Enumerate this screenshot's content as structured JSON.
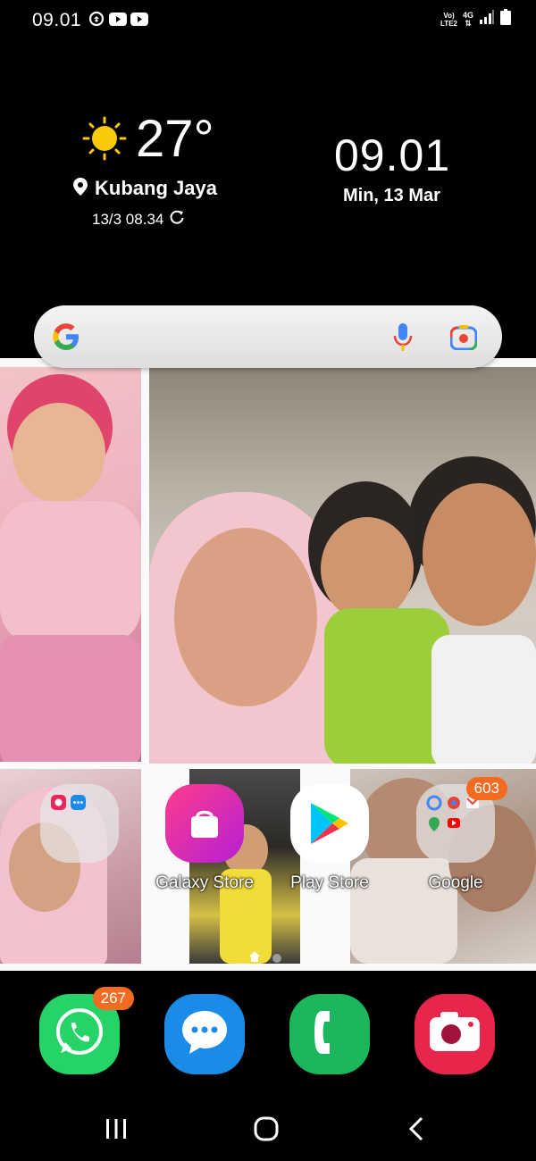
{
  "status_bar": {
    "time": "09.01",
    "left_icons": [
      "sync-icon",
      "youtube-icon",
      "youtube-icon"
    ],
    "right_icons": [
      "volte-icon",
      "4g-icon",
      "signal-icon",
      "battery-icon"
    ],
    "volte_top": "Vo)",
    "volte_bottom": "LTE2",
    "network_label": "4G"
  },
  "weather": {
    "temperature": "27°",
    "location": "Kubang Jaya",
    "updated": "13/3 08.34",
    "icon": "sun-icon"
  },
  "clock": {
    "time": "09.01",
    "date": "Min, 13 Mar"
  },
  "search": {
    "icons": [
      "google-logo",
      "mic-icon",
      "lens-icon"
    ]
  },
  "apps": [
    {
      "name": "folder",
      "label": ""
    },
    {
      "name": "galaxy-store",
      "label": "Galaxy Store"
    },
    {
      "name": "play-store",
      "label": "Play Store"
    },
    {
      "name": "google-folder",
      "label": "Google",
      "badge": "603"
    }
  ],
  "dock": [
    {
      "name": "whatsapp",
      "badge": "267"
    },
    {
      "name": "messages"
    },
    {
      "name": "phone"
    },
    {
      "name": "camera"
    }
  ],
  "colors": {
    "badge": "#f26b21",
    "whatsapp": "#25d366",
    "messages": "#1a8be6",
    "phone": "#1cb65c",
    "camera": "#e8254b"
  }
}
